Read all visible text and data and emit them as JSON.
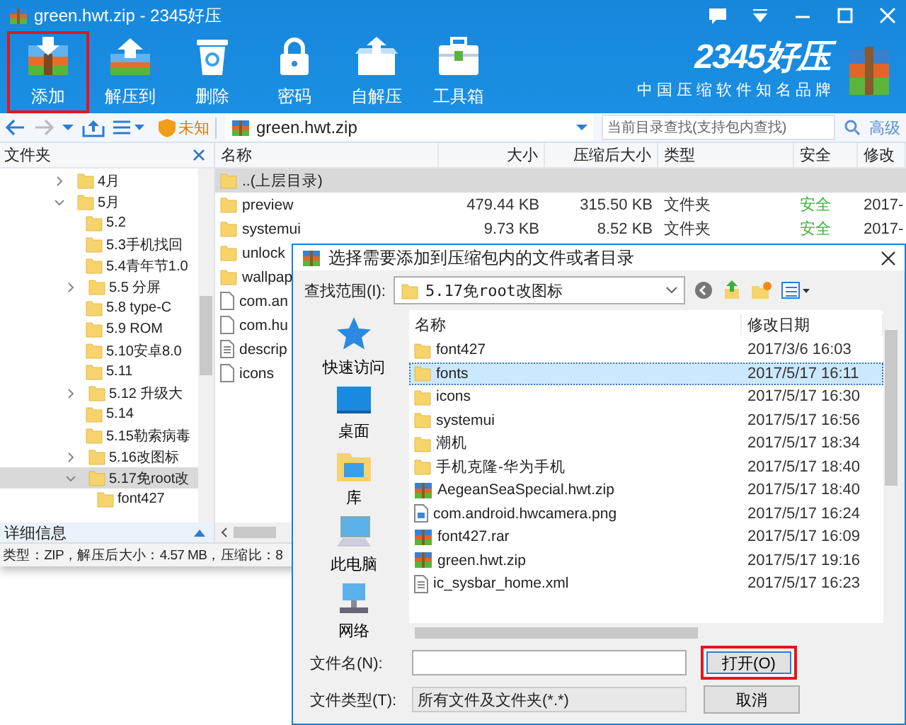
{
  "window": {
    "title": "green.hwt.zip - 2345好压"
  },
  "toolbar": [
    {
      "label": "添加",
      "highlighted": true
    },
    {
      "label": "解压到",
      "highlighted": false
    },
    {
      "label": "删除",
      "highlighted": false
    },
    {
      "label": "密码",
      "highlighted": false
    },
    {
      "label": "自解压",
      "highlighted": false
    },
    {
      "label": "工具箱",
      "highlighted": false
    }
  ],
  "brand": {
    "name": "2345好压",
    "slogan": "中国压缩软件知名品牌"
  },
  "address_bar": {
    "badge": "未知",
    "path": "green.hwt.zip",
    "search": {
      "placeholder": "当前目录查找(支持包内查找)"
    },
    "advanced": "高级"
  },
  "folder_pane": {
    "title": "文件夹",
    "tree": [
      {
        "label": "4月",
        "expanded": false,
        "selected": false
      },
      {
        "label": "5月",
        "expanded": true,
        "selected": false,
        "children": [
          {
            "label": "5.2",
            "selected": false
          },
          {
            "label": "5.3手机找回",
            "selected": false
          },
          {
            "label": "5.4青年节1.0",
            "selected": false
          },
          {
            "label": "5.5 分屏",
            "expanded": false,
            "selected": false
          },
          {
            "label": "5.8 type-C",
            "selected": false
          },
          {
            "label": "5.9 ROM",
            "selected": false
          },
          {
            "label": "5.10安卓8.0",
            "selected": false
          },
          {
            "label": "5.11",
            "selected": false
          },
          {
            "label": "5.12 升级大",
            "expanded": false,
            "selected": false
          },
          {
            "label": "5.14",
            "selected": false
          },
          {
            "label": "5.15勒索病毒",
            "selected": false
          },
          {
            "label": "5.16改图标",
            "expanded": false,
            "selected": false
          },
          {
            "label": "5.17免root改",
            "expanded": true,
            "selected": true,
            "children": [
              {
                "label": "font427",
                "selected": false
              }
            ]
          }
        ]
      }
    ]
  },
  "file_list": {
    "columns": [
      "名称",
      "大小",
      "压缩后大小",
      "类型",
      "安全",
      "修改"
    ],
    "rows": [
      {
        "kind": "folder",
        "name": "..(上层目录)",
        "selected": true
      },
      {
        "kind": "folder",
        "name": "preview",
        "size": "479.44 KB",
        "packed": "315.50 KB",
        "type": "文件夹",
        "safety": "安全",
        "modified": "2017-",
        "selected": false
      },
      {
        "kind": "folder",
        "name": "systemui",
        "size": "9.73 KB",
        "packed": "8.52 KB",
        "type": "文件夹",
        "safety": "安全",
        "modified": "2017-",
        "selected": false
      },
      {
        "kind": "folder",
        "name": "unlock",
        "selected": false
      },
      {
        "kind": "folder",
        "name": "wallpap",
        "selected": false
      },
      {
        "kind": "file",
        "name": "com.an",
        "selected": false
      },
      {
        "kind": "file",
        "name": "com.hu",
        "selected": false
      },
      {
        "kind": "text",
        "name": "descrip",
        "selected": false
      },
      {
        "kind": "file",
        "name": "icons",
        "selected": false
      }
    ]
  },
  "details": {
    "title": "详细信息",
    "text": "类型：ZIP，解压后大小：4.57 MB，压缩比：8"
  },
  "dialog": {
    "title": "选择需要添加到压缩包内的文件或者目录",
    "look_in_label": "查找范围(I):",
    "look_in": "5.17免root改图标",
    "places": [
      "快速访问",
      "桌面",
      "库",
      "此电脑",
      "网络"
    ],
    "columns": [
      "名称",
      "修改日期"
    ],
    "rows": [
      {
        "kind": "folder",
        "name": "font427",
        "modified": "2017/3/6 16:03",
        "selected": false
      },
      {
        "kind": "folder",
        "name": "fonts",
        "modified": "2017/5/17 16:11",
        "selected": true
      },
      {
        "kind": "folder",
        "name": "icons",
        "modified": "2017/5/17 16:30",
        "selected": false
      },
      {
        "kind": "folder",
        "name": "systemui",
        "modified": "2017/5/17 16:56",
        "selected": false
      },
      {
        "kind": "folder",
        "name": "潮机",
        "modified": "2017/5/17 18:34",
        "selected": false
      },
      {
        "kind": "folder",
        "name": "手机克隆-华为手机",
        "modified": "2017/5/17 18:40",
        "selected": false
      },
      {
        "kind": "zip",
        "name": "AegeanSeaSpecial.hwt.zip",
        "modified": "2017/5/17 18:40",
        "selected": false
      },
      {
        "kind": "image",
        "name": "com.android.hwcamera.png",
        "modified": "2017/5/17 16:24",
        "selected": false
      },
      {
        "kind": "zip",
        "name": "font427.rar",
        "modified": "2017/5/17 16:09",
        "selected": false
      },
      {
        "kind": "zip",
        "name": "green.hwt.zip",
        "modified": "2017/5/17 19:16",
        "selected": false
      },
      {
        "kind": "text",
        "name": "ic_sysbar_home.xml",
        "modified": "2017/5/17 16:23",
        "selected": false
      }
    ],
    "filename_label": "文件名(N):",
    "filetype_label": "文件类型(T):",
    "filetype": "所有文件及文件夹(*.*)",
    "buttons": [
      {
        "label": "打开(O)",
        "highlighted": true
      },
      {
        "label": "取消",
        "highlighted": false
      }
    ]
  }
}
